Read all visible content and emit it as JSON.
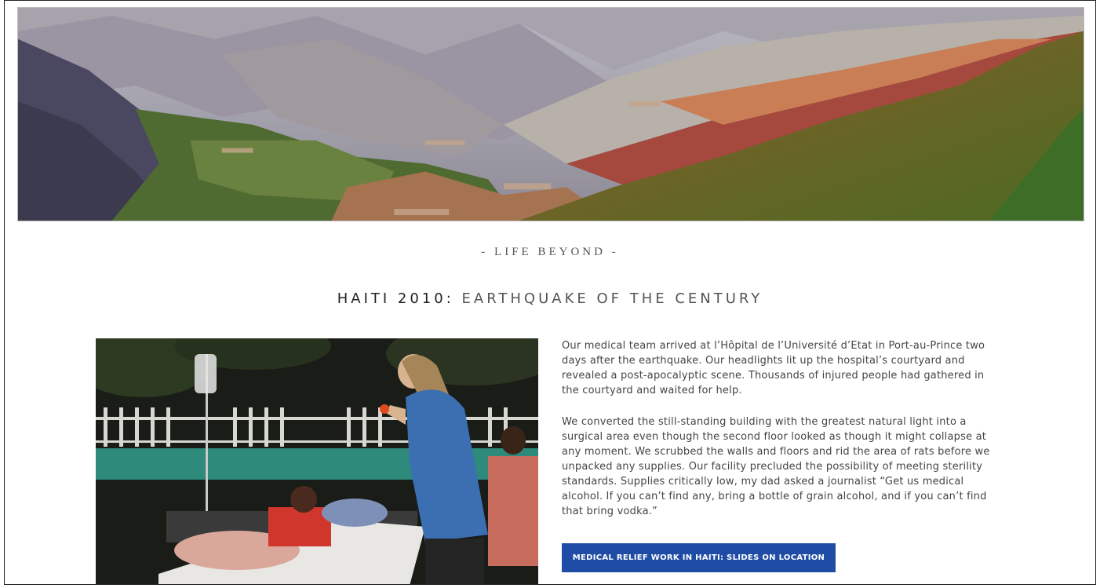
{
  "section": {
    "eyebrow": "- LIFE BEYOND -",
    "title_strong": "HAITI 2010:",
    "title_light": " EARTHQUAKE OF THE CENTURY"
  },
  "article": {
    "paragraphs": [
      "Our medical team arrived at l’Hôpital de l’Université d’Etat in Port-au-Prince two days after the earthquake. Our headlights lit up the hospital’s courtyard and revealed a post-apocalyptic scene. Thousands of injured people had gathered in the courtyard and waited for help.",
      "We converted the still-standing building with the greatest natural light into a surgical area even though the second floor looked as though it might collapse at any moment. We scrubbed the walls and floors and rid the area of rats before we unpacked any supplies. Our facility precluded the possibility of meeting sterility standards. Supplies critically low, my dad asked a journalist “Get us medical alcohol. If you can’t find any, bring a bottle of grain alcohol, and if you can’t find that bring vodka.”"
    ],
    "cta_label": "MEDICAL RELIEF WORK IN HAITI: SLIDES ON LOCATION"
  },
  "colors": {
    "cta_background": "#1f4da6",
    "page_background": "#ffffff"
  }
}
